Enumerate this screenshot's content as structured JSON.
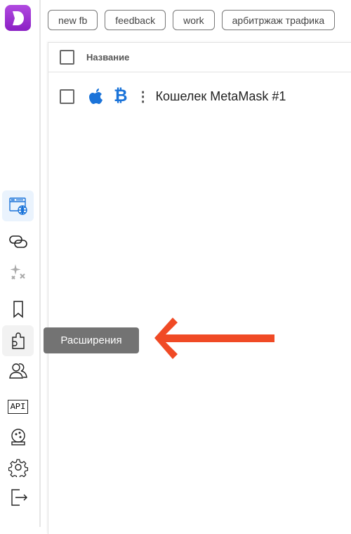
{
  "sidebar": {
    "items": [
      {
        "id": "browser-profiles",
        "state": "active"
      },
      {
        "id": "proxies"
      },
      {
        "id": "automation"
      },
      {
        "id": "bookmarks"
      },
      {
        "id": "extensions",
        "state": "hover"
      },
      {
        "id": "team"
      },
      {
        "id": "api",
        "label": "API"
      },
      {
        "id": "fortune"
      },
      {
        "id": "settings"
      },
      {
        "id": "logout"
      }
    ]
  },
  "tags": [
    "new fb",
    "feedback",
    "work",
    "арбитржаж трафика"
  ],
  "table": {
    "header": "Название",
    "rows": [
      {
        "name": "Кошелек MetaMask #1",
        "os": "apple-icon",
        "tag_icon": "bitcoin-icon"
      }
    ]
  },
  "tooltip": "Расширения",
  "colors": {
    "accent": "#1a73d9",
    "logo": "#9b30d4",
    "arrow": "#f04a25",
    "tooltip": "#737373"
  }
}
